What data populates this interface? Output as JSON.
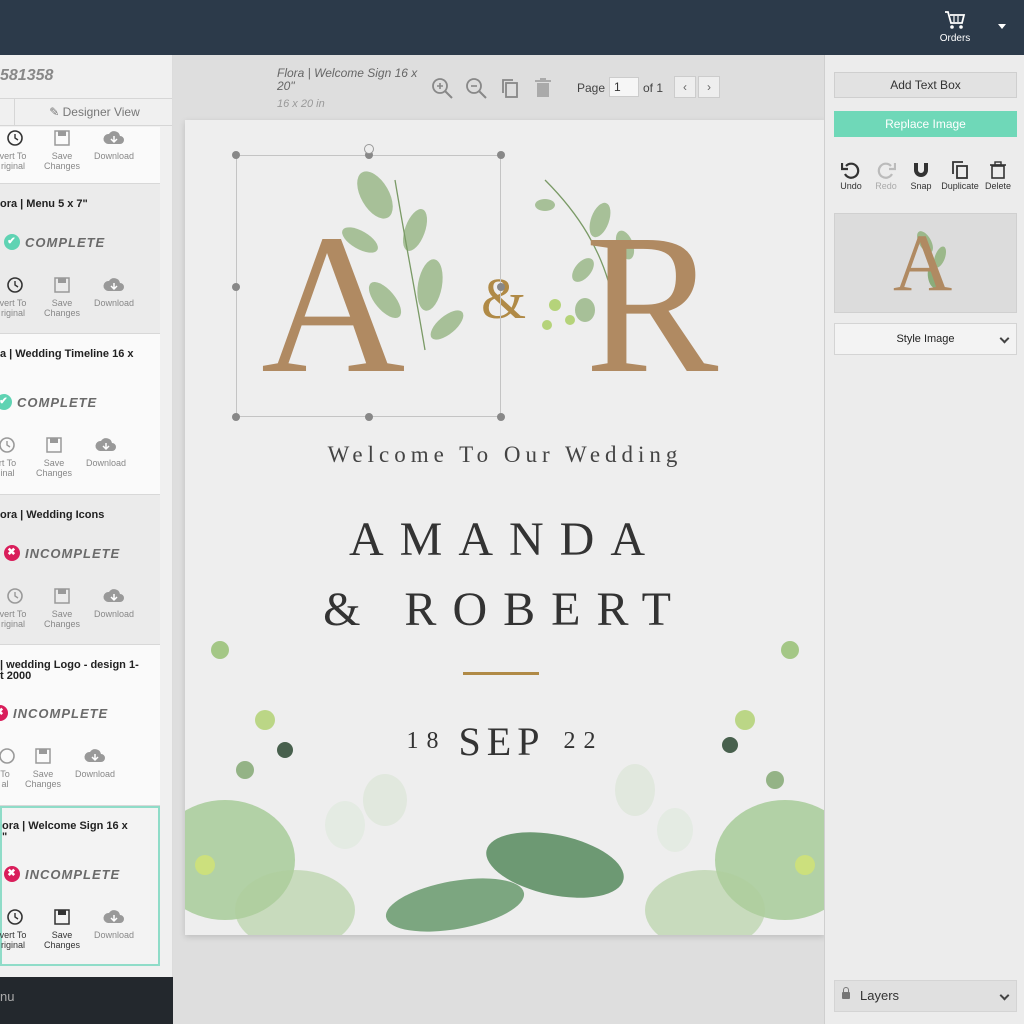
{
  "header": {
    "orders_label": "Orders"
  },
  "sidebar": {
    "order_id": "581358",
    "designer_view_label": "Designer View",
    "projects": [
      {
        "title": "",
        "status": "",
        "actions": [
          "vert To\nriginal",
          "Save\nChanges",
          "Download"
        ]
      },
      {
        "title": "ora | Menu 5 x 7\"",
        "status": "COMPLETE",
        "actions": [
          "vert To\nriginal",
          "Save\nChanges",
          "Download"
        ]
      },
      {
        "title": "a | Wedding Timeline 16 x",
        "status": "COMPLETE",
        "actions": [
          "ert To\nginal",
          "Save\nChanges",
          "Download"
        ]
      },
      {
        "title": "ora | Wedding Icons",
        "status": "INCOMPLETE",
        "actions": [
          "vert To\nriginal",
          "Save\nChanges",
          "Download"
        ]
      },
      {
        "title": "| wedding Logo - design 1-\nt 2000",
        "status": "INCOMPLETE",
        "actions": [
          "To\nal",
          "Save\nChanges",
          "Download"
        ]
      },
      {
        "title": "ora | Welcome Sign 16 x\n\"",
        "status": "INCOMPLETE",
        "actions": [
          "vert To\nriginal",
          "Save\nChanges",
          "Download"
        ]
      }
    ],
    "bottom_menu": "nu"
  },
  "toolbar": {
    "doc_title": "Flora | Welcome Sign 16 x 20\"",
    "doc_size": "16 x 20 in",
    "page_label": "Page",
    "page_value": "1",
    "page_of": "of 1",
    "prev": "‹",
    "next": "›"
  },
  "sign": {
    "mono_left": "A",
    "ampersand": "&",
    "mono_right": "R",
    "welcome": "Welcome To Our Wedding",
    "name_line1": "AMANDA",
    "name_line2": "& ROBERT",
    "date_day": "18",
    "date_month": "SEP",
    "date_year": "22"
  },
  "right_panel": {
    "add_text": "Add Text Box",
    "replace_image": "Replace Image",
    "tools": [
      {
        "label": "Undo"
      },
      {
        "label": "Redo"
      },
      {
        "label": "Snap"
      },
      {
        "label": "Duplicate"
      },
      {
        "label": "Delete"
      }
    ],
    "preview_letter": "A",
    "style_image": "Style Image",
    "layers": "Layers"
  },
  "colors": {
    "accent": "#6fd8b8",
    "incomplete": "#d91e5b",
    "gold": "#b08a46",
    "topbar": "#2c3a4a"
  }
}
